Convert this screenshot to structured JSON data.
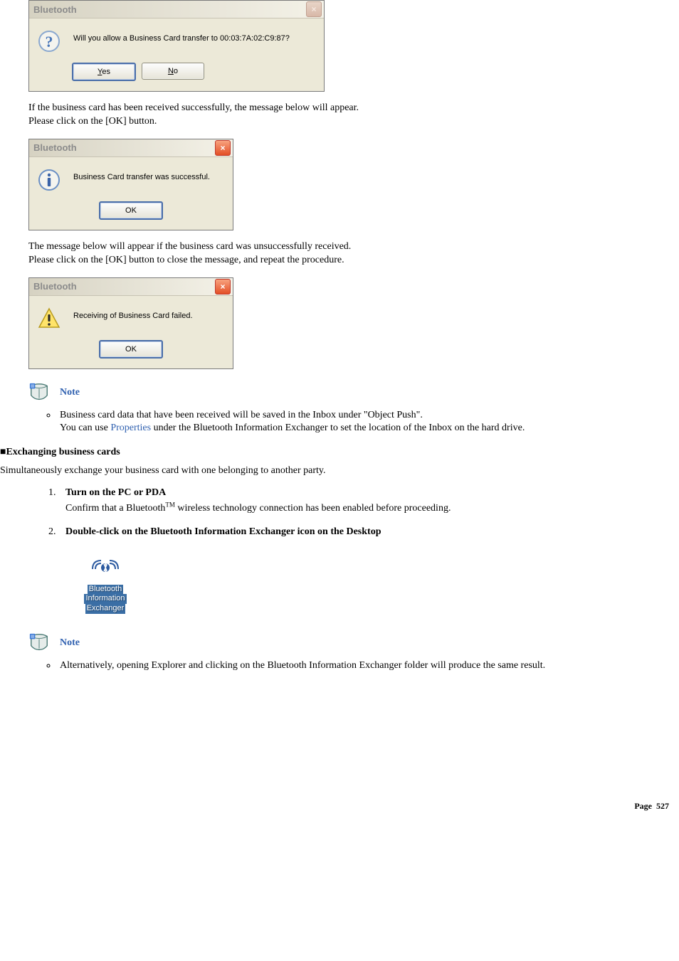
{
  "dialogs": {
    "confirm": {
      "title": "Bluetooth",
      "message": "Will you allow a Business Card transfer to 00:03:7A:02:C9:87?",
      "yes": "Yes",
      "no": "No"
    },
    "success": {
      "title": "Bluetooth",
      "message": "Business Card transfer was successful.",
      "ok": "OK"
    },
    "failed": {
      "title": "Bluetooth",
      "message": "Receiving of Business Card failed.",
      "ok": "OK"
    }
  },
  "text": {
    "p1a": "If the business card has been received successfully, the message below will appear.",
    "p1b": "Please click on the [OK] button.",
    "p2a": "The message below will appear if the business card was unsuccessfully received.",
    "p2b": "Please click on the [OK] button to close the message, and repeat the procedure.",
    "note1": "Note",
    "note1_item_a": "Business card data that have been received will be saved in the Inbox under \"Object Push\".",
    "note1_item_b_pre": "You can use ",
    "note1_item_b_link": "Properties",
    "note1_item_b_post": " under the Bluetooth Information Exchanger to set the location of the Inbox on the hard drive.",
    "section_bullet": "■",
    "section_title": "Exchanging business cards",
    "section_intro": "Simultaneously exchange your business card with one belonging to another party.",
    "step1_title": "Turn on the PC or PDA",
    "step1_body_pre": "Confirm that a Bluetooth",
    "step1_body_tm": "TM",
    "step1_body_post": " wireless technology connection has been enabled before proceeding.",
    "step2_title": "Double-click on the Bluetooth Information Exchanger icon on the Desktop",
    "desktop_icon_l1": "Bluetooth",
    "desktop_icon_l2": "Information",
    "desktop_icon_l3": "Exchanger",
    "note2": "Note",
    "note2_item": "Alternatively, opening Explorer and clicking on the Bluetooth Information Exchanger folder will produce the same result.",
    "footer_label": "Page",
    "footer_num": "527"
  }
}
